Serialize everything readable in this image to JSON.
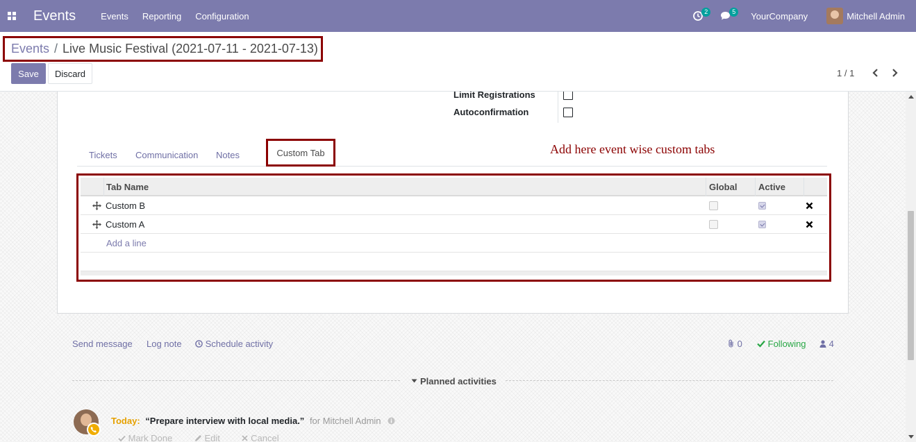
{
  "navbar": {
    "app_name": "Events",
    "menu": [
      "Events",
      "Reporting",
      "Configuration"
    ],
    "activity_count": "2",
    "message_count": "5",
    "company": "YourCompany",
    "user": "Mitchell Admin"
  },
  "breadcrumb": {
    "parent": "Events",
    "separator": "/",
    "current": "Live Music Festival (2021-07-11 - 2021-07-13)"
  },
  "buttons": {
    "save": "Save",
    "discard": "Discard"
  },
  "pager": {
    "value": "1 / 1"
  },
  "form": {
    "fields": [
      {
        "label": "Limit Registrations",
        "checked": false
      },
      {
        "label": "Autoconfirmation",
        "checked": false
      }
    ],
    "tabs": [
      "Tickets",
      "Communication",
      "Notes",
      "Custom Tab"
    ],
    "active_tab": "Custom Tab",
    "annotation": "Add here event wise custom tabs"
  },
  "custom_tab_table": {
    "columns": [
      "Tab Name",
      "Global",
      "Active"
    ],
    "rows": [
      {
        "name": "Custom B",
        "global": false,
        "active": true
      },
      {
        "name": "Custom A",
        "global": false,
        "active": true
      }
    ],
    "add_line": "Add a line"
  },
  "chatter": {
    "send_message": "Send message",
    "log_note": "Log note",
    "schedule_activity": "Schedule activity",
    "attachments": "0",
    "following": "Following",
    "followers": "4",
    "planned_title": "Planned activities",
    "activity": {
      "when": "Today:",
      "summary": "“Prepare interview with local media.”",
      "for": "for Mitchell Admin",
      "mark_done": "Mark Done",
      "edit": "Edit",
      "cancel": "Cancel"
    }
  },
  "colors": {
    "brand": "#7c7bad",
    "highlight_border": "#8b0000",
    "following": "#28a745",
    "today": "#e6a100"
  }
}
